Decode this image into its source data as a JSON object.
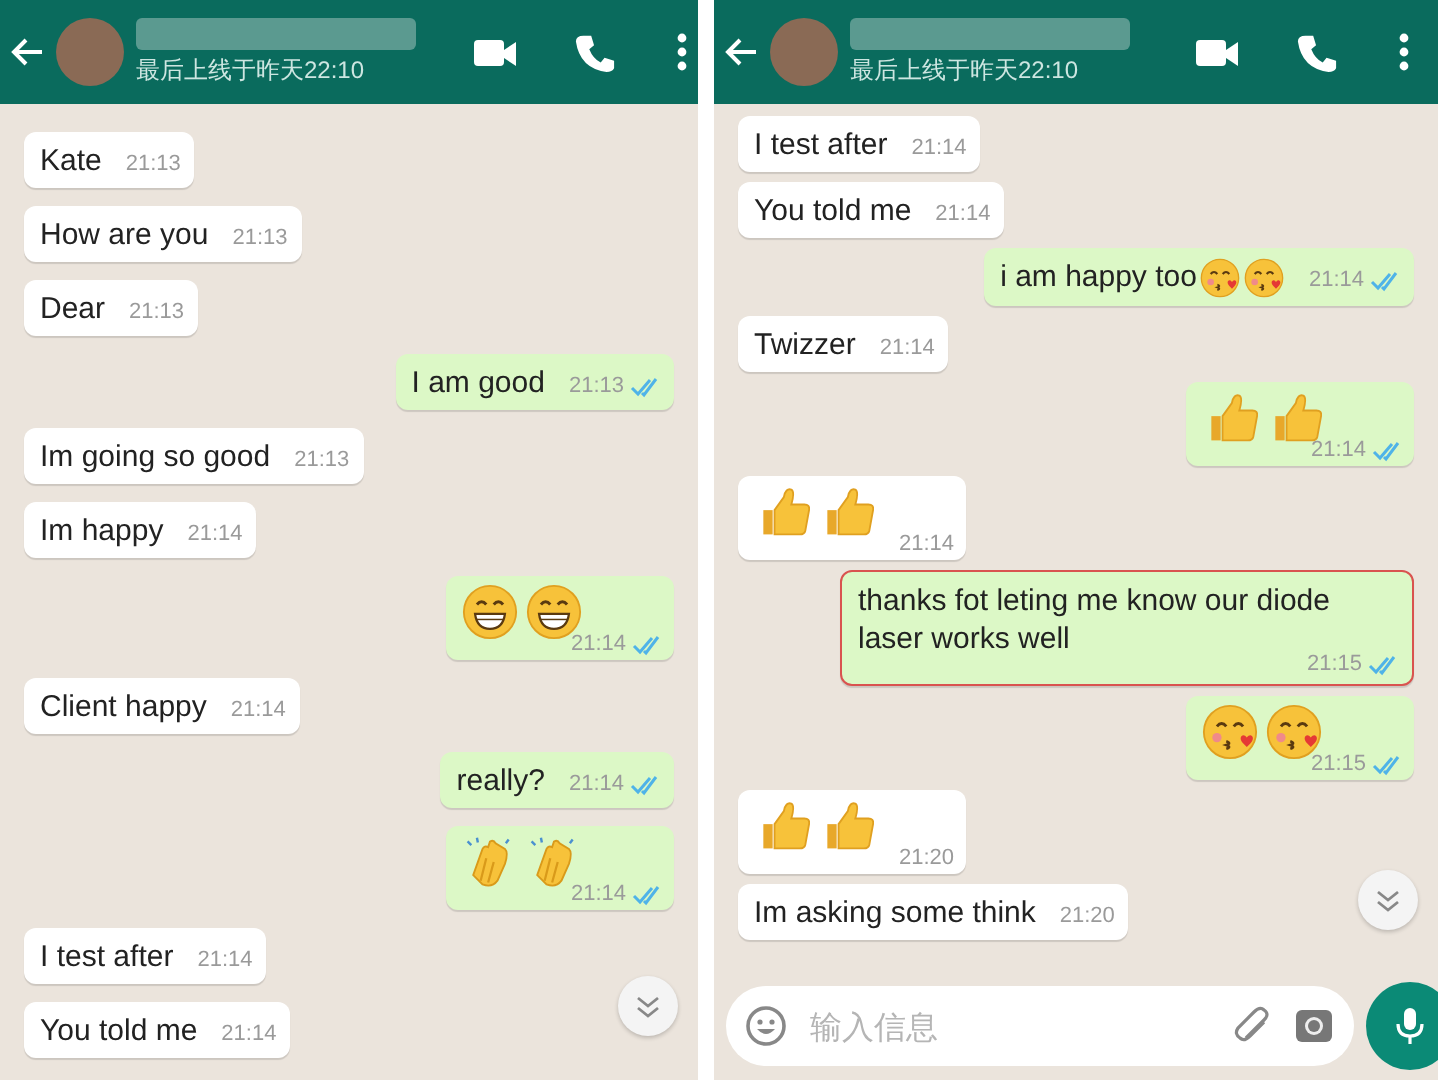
{
  "panels": [
    {
      "header": {
        "subtitle": "最后上线于昨天22:10"
      },
      "messages": [
        {
          "kind": "text",
          "outgoing": false,
          "text": "Kate",
          "time": "21:13"
        },
        {
          "kind": "text",
          "outgoing": false,
          "text": "How are you",
          "time": "21:13"
        },
        {
          "kind": "text",
          "outgoing": false,
          "text": "Dear",
          "time": "21:13"
        },
        {
          "kind": "text",
          "outgoing": true,
          "read": true,
          "text": "I am good",
          "time": "21:13"
        },
        {
          "kind": "text",
          "outgoing": false,
          "text": "Im going so good",
          "time": "21:13"
        },
        {
          "kind": "text",
          "outgoing": false,
          "text": "Im happy",
          "time": "21:14"
        },
        {
          "kind": "grin",
          "outgoing": true,
          "read": true,
          "time": "21:14"
        },
        {
          "kind": "text",
          "outgoing": false,
          "text": "Client happy",
          "time": "21:14"
        },
        {
          "kind": "text",
          "outgoing": true,
          "read": true,
          "text": "really?",
          "time": "21:14"
        },
        {
          "kind": "clap",
          "outgoing": true,
          "read": true,
          "time": "21:14"
        },
        {
          "kind": "text",
          "outgoing": false,
          "text": "I test after",
          "time": "21:14"
        },
        {
          "kind": "text",
          "outgoing": false,
          "text": "You told me",
          "time": "21:14"
        }
      ]
    },
    {
      "header": {
        "subtitle": "最后上线于昨天22:10"
      },
      "messages": [
        {
          "kind": "text",
          "outgoing": false,
          "text": "I test after",
          "time": "21:14"
        },
        {
          "kind": "text",
          "outgoing": false,
          "text": "You told me",
          "time": "21:14"
        },
        {
          "kind": "mixed",
          "outgoing": true,
          "read": true,
          "text": "i am happy too",
          "time": "21:14"
        },
        {
          "kind": "text",
          "outgoing": false,
          "text": "Twizzer",
          "time": "21:14"
        },
        {
          "kind": "thumbs",
          "outgoing": true,
          "read": true,
          "time": "21:14"
        },
        {
          "kind": "thumbs",
          "outgoing": false,
          "time": "21:14"
        },
        {
          "kind": "text",
          "outgoing": true,
          "read": true,
          "outlined": true,
          "text": "thanks fot leting me know our diode laser works well",
          "time": "21:15"
        },
        {
          "kind": "kiss",
          "outgoing": true,
          "read": true,
          "time": "21:15"
        },
        {
          "kind": "thumbs",
          "outgoing": false,
          "time": "21:20"
        },
        {
          "kind": "text",
          "outgoing": false,
          "text": "Im asking some think",
          "time": "21:20"
        }
      ],
      "composer": {
        "placeholder": "输入信息"
      }
    }
  ]
}
